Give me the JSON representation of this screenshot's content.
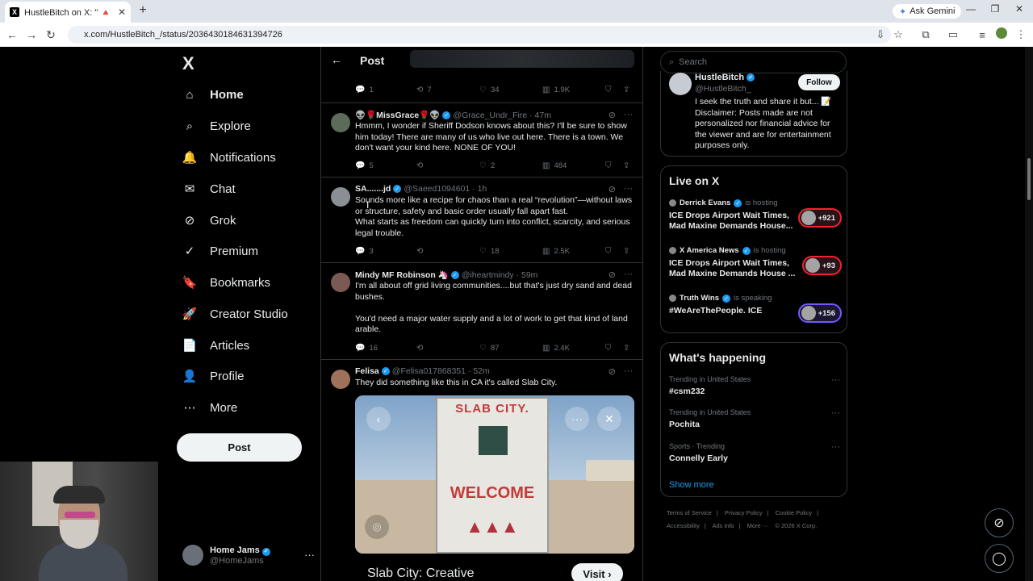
{
  "browser": {
    "tab_title": "HustleBitch on X: \" 🔺 \"NO LAW",
    "new_tab": "+",
    "ask_gemini": "Ask Gemini",
    "url": "x.com/HustleBitch_/status/2036430184631394726",
    "minimize": "—",
    "maximize": "❐",
    "close": "✕"
  },
  "nav": {
    "logo": "X",
    "items": [
      {
        "label": "Home",
        "icon": "home-icon",
        "glyph": "⌂"
      },
      {
        "label": "Explore",
        "icon": "search-icon",
        "glyph": "⌕"
      },
      {
        "label": "Notifications",
        "icon": "bell-icon",
        "glyph": "🔔"
      },
      {
        "label": "Chat",
        "icon": "mail-icon",
        "glyph": "✉"
      },
      {
        "label": "Grok",
        "icon": "grok-icon",
        "glyph": "⊘"
      },
      {
        "label": "Premium",
        "icon": "premium-icon",
        "glyph": "✓"
      },
      {
        "label": "Bookmarks",
        "icon": "bookmark-icon",
        "glyph": "🔖"
      },
      {
        "label": "Creator Studio",
        "icon": "rocket-icon",
        "glyph": "🚀"
      },
      {
        "label": "Articles",
        "icon": "article-icon",
        "glyph": "📄"
      },
      {
        "label": "Profile",
        "icon": "person-icon",
        "glyph": "👤"
      },
      {
        "label": "More",
        "icon": "more-icon",
        "glyph": "⋯"
      }
    ],
    "post_button": "Post",
    "account": {
      "name": "Home Jams",
      "handle": "@HomeJams",
      "menu": "···"
    }
  },
  "header": {
    "title": "Post",
    "back": "←"
  },
  "posts": [
    {
      "stats": {
        "reply": "1",
        "repost": "7",
        "like": "34",
        "views": "1.9K"
      }
    },
    {
      "name": "👽🌹MissGrace🌹👽",
      "handle": "@Grace_Undr_Fire · 47m",
      "text": "Hmmm, I wonder if Sheriff Dodson knows about this? I'll be sure to show him today! There are many of us who live out here. There is a town. We don't want your kind here. NONE OF YOU!",
      "stats": {
        "reply": "5",
        "repost": "",
        "like": "2",
        "views": "484"
      }
    },
    {
      "name": "SA.......jd",
      "handle": "@Saeed1094601 · 1h",
      "text": "Sounds more like a recipe for chaos than a real “revolution”—without laws or structure, safety and basic order usually fall apart fast.\nWhat starts as freedom can quickly turn into conflict, scarcity, and serious legal trouble.",
      "stats": {
        "reply": "3",
        "repost": "",
        "like": "18",
        "views": "2.5K"
      }
    },
    {
      "name": "Mindy MF Robinson 🦄",
      "handle": "@iheartmindy · 59m",
      "text": "I'm all about off grid living communities....but that's just dry sand and dead bushes.\n\nYou'd need a major water supply and a lot of work to get that kind of land arable.",
      "stats": {
        "reply": "16",
        "repost": "",
        "like": "87",
        "views": "2.4K"
      }
    },
    {
      "name": "Felisa",
      "handle": "@Felisa017868351 · 52m",
      "text": "They did something like this in CA it's called Slab City.",
      "media": {
        "sign_top": "SLAB CITY.",
        "sign_main": "WELCOME",
        "card_title": "Slab City: Creative",
        "visit": "Visit ›"
      }
    }
  ],
  "sidebar": {
    "search_placeholder": "Search",
    "profile": {
      "name": "HustleBitch",
      "handle": "@HustleBitch_",
      "follow": "Follow",
      "bio": "I seek the truth and share it but... 📝 Disclaimer: Posts made are not personalized nor financial advice for the viewer and are for entertainment purposes only."
    },
    "live": {
      "title": "Live on X",
      "items": [
        {
          "host": "Derrick Evans",
          "status": "is hosting",
          "title": "ICE Drops Airport Wait Times, Mad Maxine Demands House...",
          "count": "+921",
          "accent": "#f4212e"
        },
        {
          "host": "X America News",
          "status": "is hosting",
          "title": "ICE Drops Airport Wait Times, Mad Maxine Demands House ...",
          "count": "+93",
          "accent": "#f4212e"
        },
        {
          "host": "Truth Wins",
          "status": "is speaking",
          "title": "#WeAreThePeople. ICE",
          "count": "+156",
          "accent": "#7856ff"
        }
      ]
    },
    "happening": {
      "title": "What's happening",
      "trends": [
        {
          "context": "Trending in United States",
          "topic": "#csm232"
        },
        {
          "context": "Trending in United States",
          "topic": "Pochita"
        },
        {
          "context": "Sports · Trending",
          "topic": "Connelly Early"
        }
      ],
      "show_more": "Show more"
    },
    "footer": [
      "Terms of Service",
      "|",
      "Privacy Policy",
      "|",
      "Cookie Policy",
      "|",
      "Accessibility",
      "|",
      "Ads info",
      "|",
      "More ···",
      "© 2026 X Corp."
    ]
  }
}
